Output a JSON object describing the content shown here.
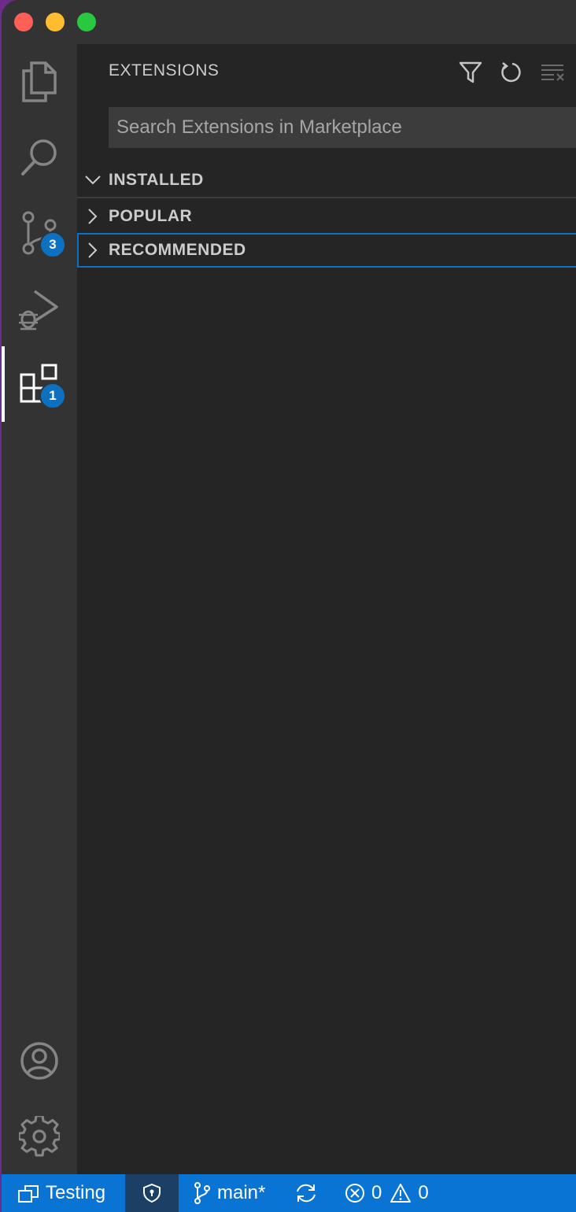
{
  "sidebar": {
    "title": "EXTENSIONS",
    "search_placeholder": "Search Extensions in Marketplace",
    "sections": [
      {
        "label": "INSTALLED",
        "expanded": true
      },
      {
        "label": "POPULAR",
        "expanded": false
      },
      {
        "label": "RECOMMENDED",
        "expanded": false,
        "focused": true
      }
    ],
    "actions": [
      "filter-icon",
      "refresh-icon",
      "clear-icon"
    ]
  },
  "activity_bar": {
    "items": [
      {
        "name": "explorer-icon"
      },
      {
        "name": "search-icon"
      },
      {
        "name": "source-control-icon",
        "badge": "3"
      },
      {
        "name": "run-debug-icon"
      },
      {
        "name": "extensions-icon",
        "badge": "1",
        "active": true
      }
    ],
    "bottom": [
      "accounts-icon",
      "manage-gear-icon"
    ]
  },
  "status_bar": {
    "remote_label": "Testing",
    "branch": "main*",
    "errors": "0",
    "warnings": "0"
  },
  "colors": {
    "accent": "#0a74d4",
    "badge": "#0e70c0",
    "sidebar_bg": "#252526",
    "activity_bg": "#333333"
  }
}
